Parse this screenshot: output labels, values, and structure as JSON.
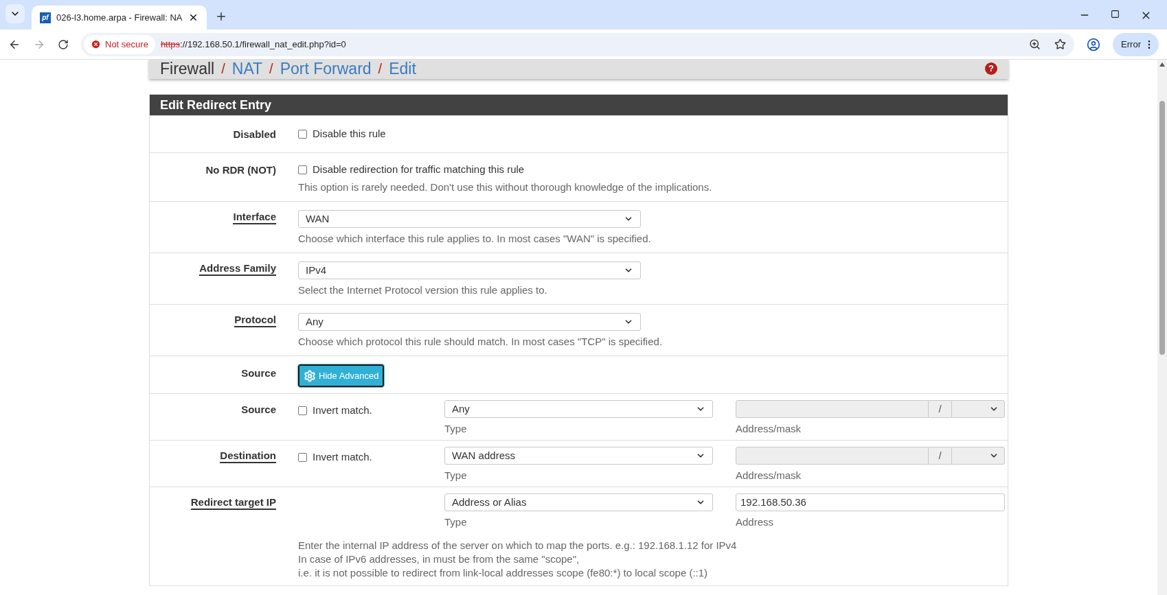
{
  "browser": {
    "favicon_text": "pf",
    "tab_title": "026-l3.home.arpa - Firewall: NA",
    "security": "Not secure",
    "url_scheme": "https",
    "url_rest": "://192.168.50.1/firewall_nat_edit.php?id=0",
    "profile_button": "Error"
  },
  "breadcrumb": {
    "items": [
      {
        "label": "Firewall",
        "link": false
      },
      {
        "label": "NAT",
        "link": true
      },
      {
        "label": "Port Forward",
        "link": true
      },
      {
        "label": "Edit",
        "link": true
      }
    ],
    "separator": "/",
    "help_icon": "?"
  },
  "panel": {
    "title": "Edit Redirect Entry",
    "rows": [
      {
        "kind": "checkbox",
        "label": "Disabled",
        "underlined": false,
        "checkbox_label": "Disable this rule",
        "checked": false
      },
      {
        "kind": "checkbox",
        "label": "No RDR (NOT)",
        "underlined": false,
        "checkbox_label": "Disable redirection for traffic matching this rule",
        "checked": false,
        "help": "This option is rarely needed. Don't use this without thorough knowledge of the implications."
      },
      {
        "kind": "select",
        "label": "Interface",
        "underlined": true,
        "value": "WAN",
        "help": "Choose which interface this rule applies to. In most cases \"WAN\" is specified."
      },
      {
        "kind": "select",
        "label": "Address Family",
        "underlined": true,
        "value": "IPv4",
        "help": "Select the Internet Protocol version this rule applies to."
      },
      {
        "kind": "select",
        "label": "Protocol",
        "underlined": true,
        "value": "Any",
        "help": "Choose which protocol this rule should match. In most cases \"TCP\" is specified."
      },
      {
        "kind": "button",
        "label": "Source",
        "underlined": false,
        "button_label": "Hide Advanced"
      },
      {
        "kind": "match",
        "label": "Source",
        "underlined": false,
        "checkbox_label": "Invert match.",
        "checked": false,
        "type_value": "Any",
        "type_caption": "Type",
        "mask_separator": "/",
        "address_caption": "Address/mask"
      },
      {
        "kind": "match",
        "label": "Destination",
        "underlined": true,
        "checkbox_label": "Invert match.",
        "checked": false,
        "type_value": "WAN address",
        "type_caption": "Type",
        "mask_separator": "/",
        "address_caption": "Address/mask"
      },
      {
        "kind": "target",
        "label": "Redirect target IP",
        "underlined": true,
        "type_value": "Address or Alias",
        "type_caption": "Type",
        "address_value": "192.168.50.36",
        "address_caption": "Address",
        "help_lines": [
          "Enter the internal IP address of the server on which to map the ports. e.g.: 192.168.1.12 for IPv4",
          "In case of IPv6 addresses, in must be from the same \"scope\",",
          "i.e. it is not possible to redirect from link-local addresses scope (fe80:*) to local scope (::1)"
        ]
      }
    ]
  }
}
